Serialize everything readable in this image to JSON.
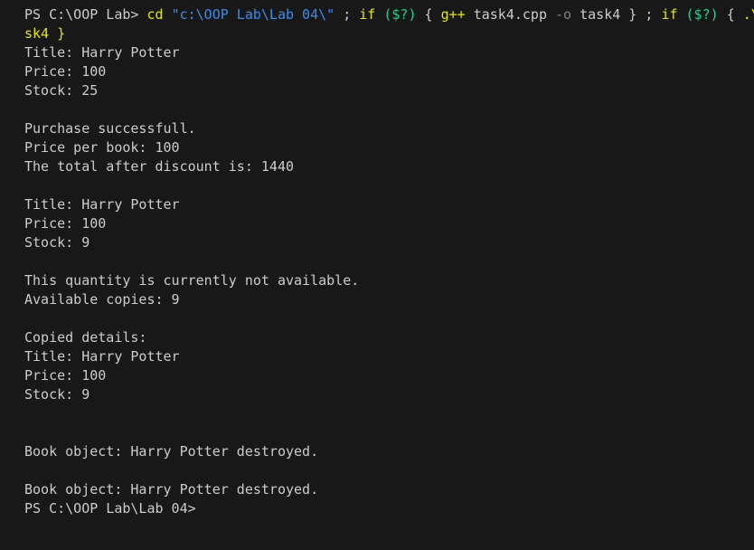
{
  "terminal": {
    "prompt1": "PS C:\\OOP Lab> ",
    "cmd": {
      "cd": "cd",
      "space1": " ",
      "path": "\"c:\\OOP Lab\\Lab 04\\\"",
      "sep1": " ; ",
      "if1": "if",
      "cond1": " ($?) ",
      "brace1": "{ ",
      "gpp": "g++",
      "file": " task4.cpp ",
      "flag": "-o",
      "out": " task4",
      "close1": " } ; ",
      "if2": "if",
      "cond2": " ($?) ",
      "brace2": "{ ",
      "run": ".\\ta",
      "wrap": "sk4 }"
    },
    "output": [
      "Title: Harry Potter",
      "Price: 100",
      "Stock: 25",
      "",
      "Purchase successfull.",
      "Price per book: 100",
      "The total after discount is: 1440",
      "",
      "Title: Harry Potter",
      "Price: 100",
      "Stock: 9",
      "",
      "This quantity is currently not available.",
      "Available copies: 9",
      "",
      "Copied details:",
      "Title: Harry Potter",
      "Price: 100",
      "Stock: 9",
      "",
      "",
      "Book object: Harry Potter destroyed.",
      "",
      "Book object: Harry Potter destroyed."
    ],
    "prompt2": "PS C:\\OOP Lab\\Lab 04>"
  }
}
